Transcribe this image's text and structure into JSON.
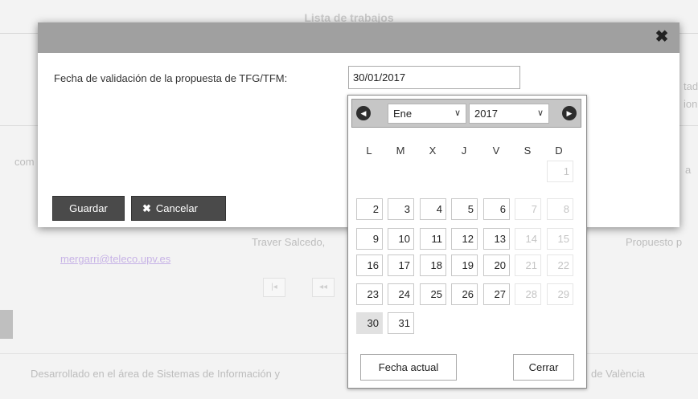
{
  "background": {
    "title": "Lista de trabajos",
    "left_snippet": "com",
    "right_snippet_1": "tad",
    "right_snippet_2": "ion",
    "right_snippet_3": "a",
    "email": "mergarri@teleco.upv.es",
    "tutor_fragment": "Traver Salcedo,",
    "status_fragment": "Propuesto p",
    "pager_first": "|◂",
    "pager_prev": "◂◂",
    "footer_left": "Desarrollado en el área de Sistemas de Información y",
    "footer_right": "de València"
  },
  "dialog": {
    "close_glyph": "✖",
    "field_label": "Fecha de validación de la propuesta de TFG/TFM:",
    "date_value": "30/01/2017",
    "save_label": "Guardar",
    "cancel_icon": "✖",
    "cancel_label": "Cancelar"
  },
  "datepicker": {
    "prev_glyph": "◀",
    "next_glyph": "▶",
    "month": "Ene",
    "year": "2017",
    "chevron": "∨",
    "weekdays": [
      "L",
      "M",
      "X",
      "J",
      "V",
      "S",
      "D"
    ],
    "selected_day": "30",
    "today_label": "Fecha actual",
    "close_label": "Cerrar",
    "weeks": [
      [
        "",
        "",
        "",
        "",
        "",
        "",
        "1"
      ],
      [
        "2",
        "3",
        "4",
        "5",
        "6",
        "7",
        "8"
      ],
      [
        "9",
        "10",
        "11",
        "12",
        "13",
        "14",
        "15"
      ],
      [
        "16",
        "17",
        "18",
        "19",
        "20",
        "21",
        "22"
      ],
      [
        "23",
        "24",
        "25",
        "26",
        "27",
        "28",
        "29"
      ],
      [
        "30",
        "31",
        "",
        "",
        "",
        "",
        ""
      ]
    ]
  },
  "icons": {
    "close": "close-icon",
    "prev": "arrow-left-circle-icon",
    "next": "arrow-right-circle-icon"
  }
}
